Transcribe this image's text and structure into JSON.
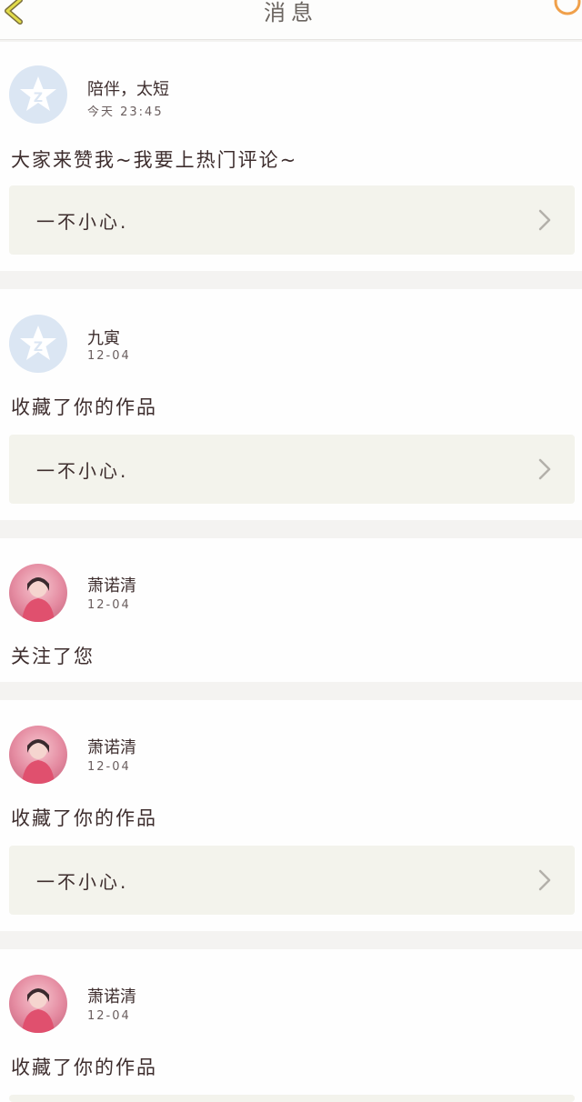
{
  "header": {
    "title": "消息"
  },
  "colors": {
    "accent": "#f0a04a",
    "back_icon": "#e2dc4a",
    "card_bg": "#fefefe",
    "work_box_bg": "#f3f3ec",
    "page_bg": "#f4f3f1"
  },
  "notifications": [
    {
      "avatar": "default-qzone-icon",
      "username": "陪伴，太短",
      "time": "今天 23:45",
      "message": "大家来赞我~我要上热门评论~",
      "work_title": "一不小心."
    },
    {
      "avatar": "default-qzone-icon",
      "username": "九寅",
      "time": "12-04",
      "message": "收藏了你的作品",
      "work_title": "一不小心."
    },
    {
      "avatar": "user-photo",
      "username": "萧诺清",
      "time": "12-04",
      "message": "关注了您"
    },
    {
      "avatar": "user-photo",
      "username": "萧诺清",
      "time": "12-04",
      "message": "收藏了你的作品",
      "work_title": "一不小心."
    },
    {
      "avatar": "user-photo",
      "username": "萧诺清",
      "time": "12-04",
      "message": "收藏了你的作品"
    }
  ]
}
